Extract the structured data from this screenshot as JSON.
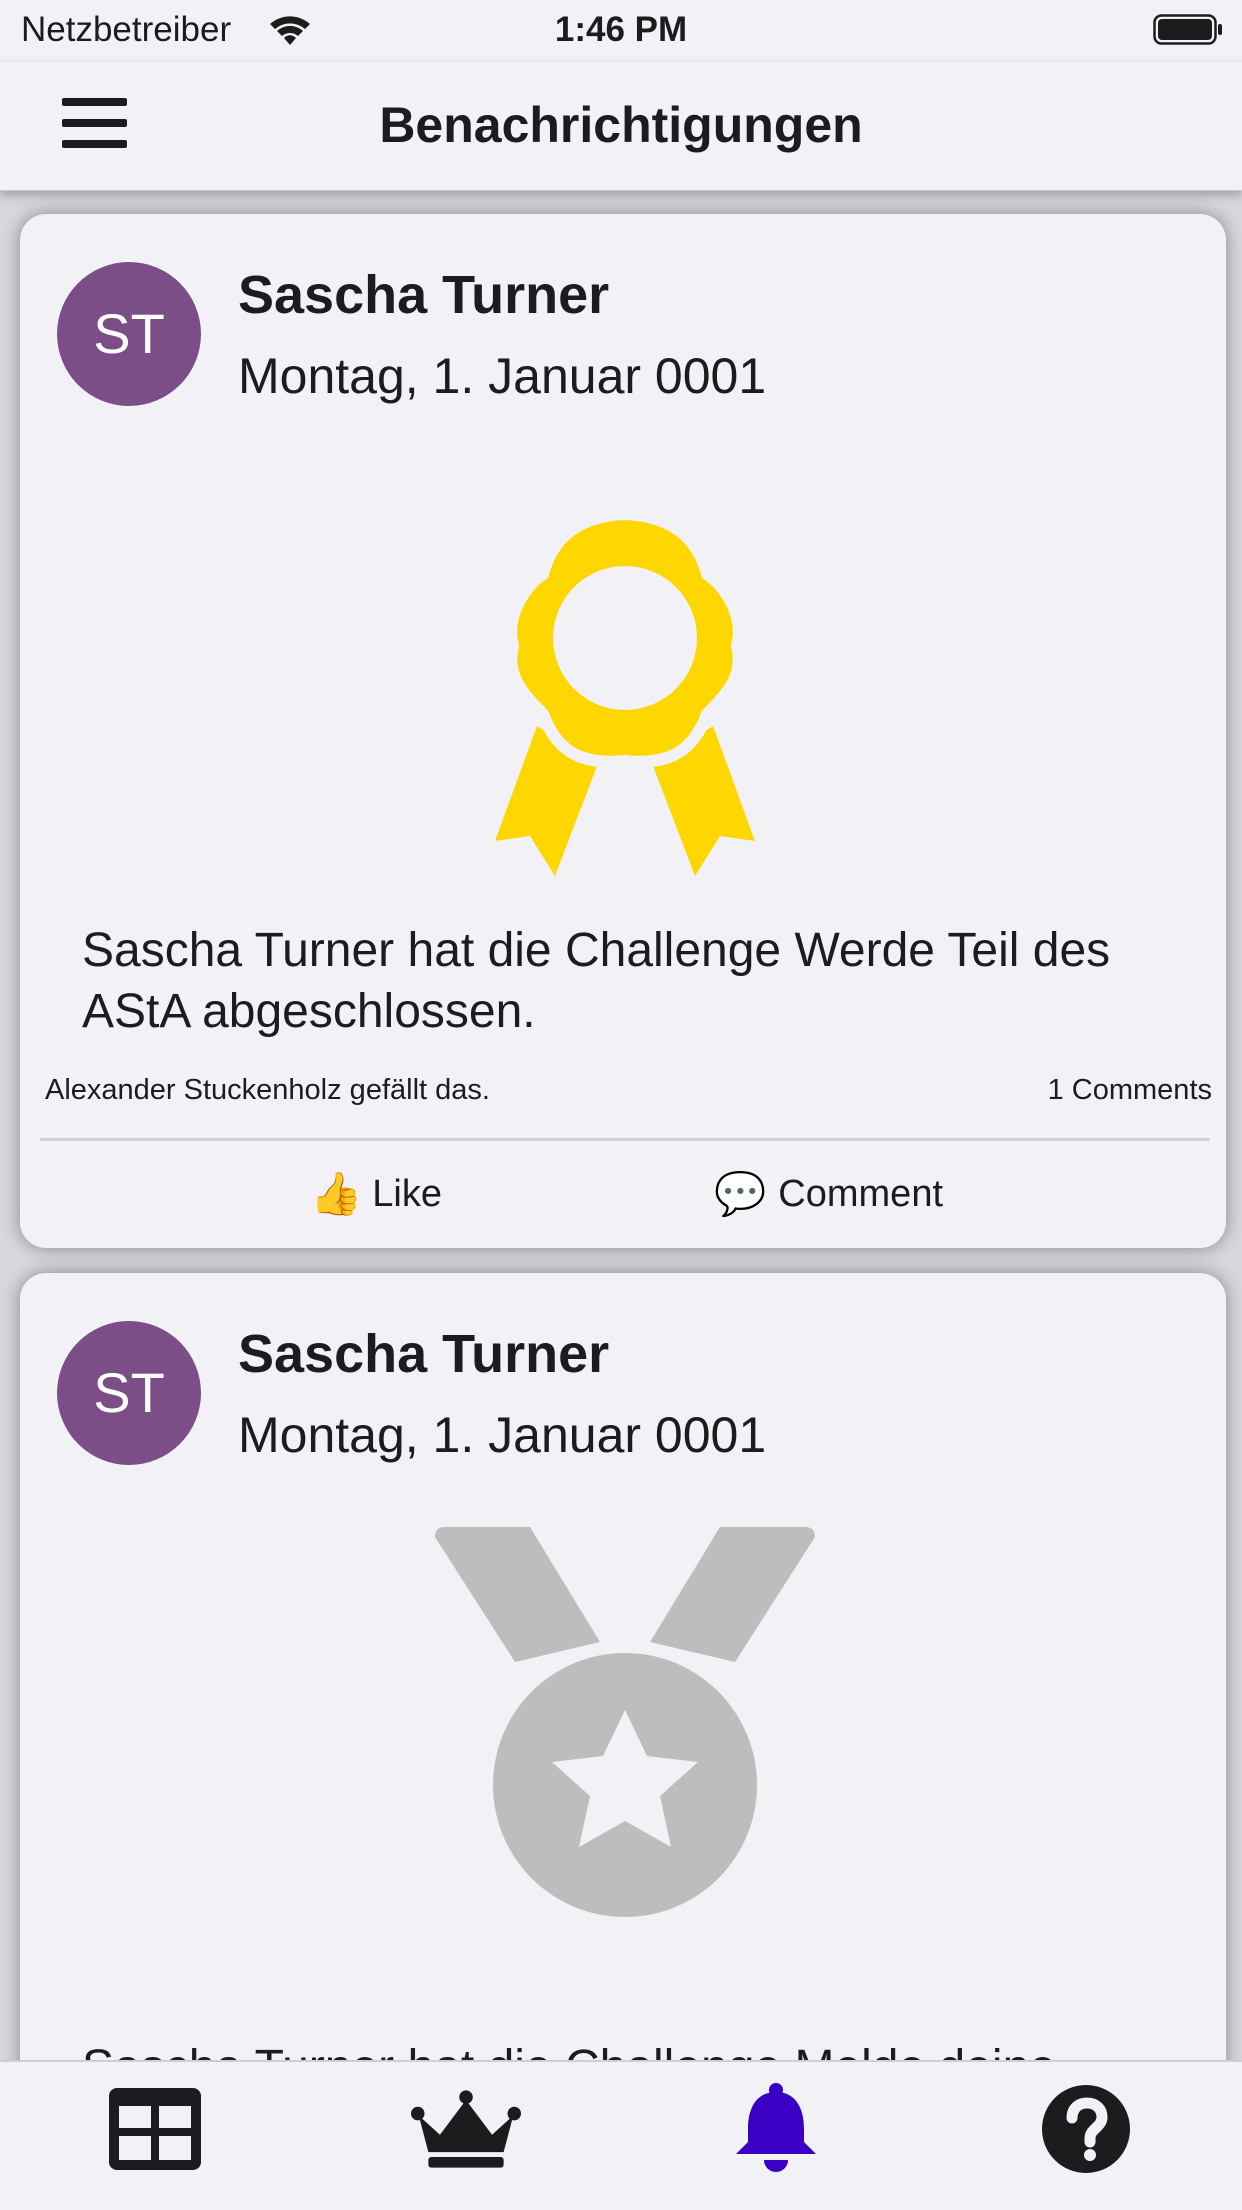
{
  "status_bar": {
    "carrier": "Netzbetreiber",
    "time": "1:46 PM"
  },
  "nav": {
    "title": "Benachrichtigungen",
    "menu_icon": "hamburger-menu-icon"
  },
  "posts": [
    {
      "avatar_initials": "ST",
      "avatar_color": "#7b4e87",
      "author": "Sascha Turner",
      "date": "Montag, 1. Januar 0001",
      "badge_icon": "award-ribbon-icon",
      "badge_color": "#ffd700",
      "message": "Sascha Turner hat die Challenge Werde Teil des AStA abgeschlossen.",
      "likes_text": "Alexander Stuckenholz gefällt das.",
      "comments_text": "1 Comments",
      "like_label": "Like",
      "comment_label": "Comment"
    },
    {
      "avatar_initials": "ST",
      "avatar_color": "#7b4e87",
      "author": "Sascha Turner",
      "date": "Montag, 1. Januar 0001",
      "badge_icon": "medal-star-icon",
      "badge_color": "#bdbdbd",
      "message": "Sascha Turner hat die Challenge Melde deine Bachelorarbeit an abgeschlossen."
    }
  ],
  "tab_bar": {
    "tabs": [
      {
        "name": "dashboard",
        "icon": "dashboard-grid-icon",
        "active": false
      },
      {
        "name": "ranking",
        "icon": "crown-icon",
        "active": false
      },
      {
        "name": "notifications",
        "icon": "bell-icon",
        "active": true
      },
      {
        "name": "help",
        "icon": "question-circle-icon",
        "active": false
      }
    ],
    "active_color": "#3a00c4",
    "inactive_color": "#1c1c1e"
  }
}
